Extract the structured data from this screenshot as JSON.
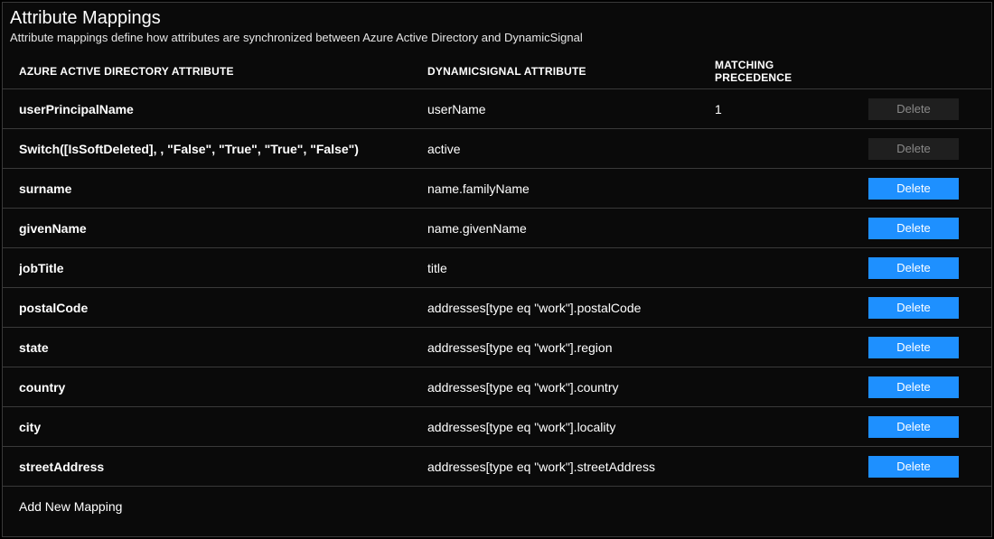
{
  "header": {
    "title": "Attribute Mappings",
    "subtitle": "Attribute mappings define how attributes are synchronized between Azure Active Directory and DynamicSignal"
  },
  "columns": {
    "azure": "AZURE ACTIVE DIRECTORY ATTRIBUTE",
    "dynamic": "DYNAMICSIGNAL ATTRIBUTE",
    "matching": "MATCHING PRECEDENCE"
  },
  "rows": [
    {
      "azure": "userPrincipalName",
      "dynamic": "userName",
      "matching": "1",
      "delete_label": "Delete",
      "delete_enabled": false
    },
    {
      "azure": "Switch([IsSoftDeleted], , \"False\", \"True\", \"True\", \"False\")",
      "dynamic": "active",
      "matching": "",
      "delete_label": "Delete",
      "delete_enabled": false
    },
    {
      "azure": "surname",
      "dynamic": "name.familyName",
      "matching": "",
      "delete_label": "Delete",
      "delete_enabled": true
    },
    {
      "azure": "givenName",
      "dynamic": "name.givenName",
      "matching": "",
      "delete_label": "Delete",
      "delete_enabled": true
    },
    {
      "azure": "jobTitle",
      "dynamic": "title",
      "matching": "",
      "delete_label": "Delete",
      "delete_enabled": true
    },
    {
      "azure": "postalCode",
      "dynamic": "addresses[type eq \"work\"].postalCode",
      "matching": "",
      "delete_label": "Delete",
      "delete_enabled": true
    },
    {
      "azure": "state",
      "dynamic": "addresses[type eq \"work\"].region",
      "matching": "",
      "delete_label": "Delete",
      "delete_enabled": true
    },
    {
      "azure": "country",
      "dynamic": "addresses[type eq \"work\"].country",
      "matching": "",
      "delete_label": "Delete",
      "delete_enabled": true
    },
    {
      "azure": "city",
      "dynamic": "addresses[type eq \"work\"].locality",
      "matching": "",
      "delete_label": "Delete",
      "delete_enabled": true
    },
    {
      "azure": "streetAddress",
      "dynamic": "addresses[type eq \"work\"].streetAddress",
      "matching": "",
      "delete_label": "Delete",
      "delete_enabled": true
    }
  ],
  "footer": {
    "add_new_mapping": "Add New Mapping"
  }
}
